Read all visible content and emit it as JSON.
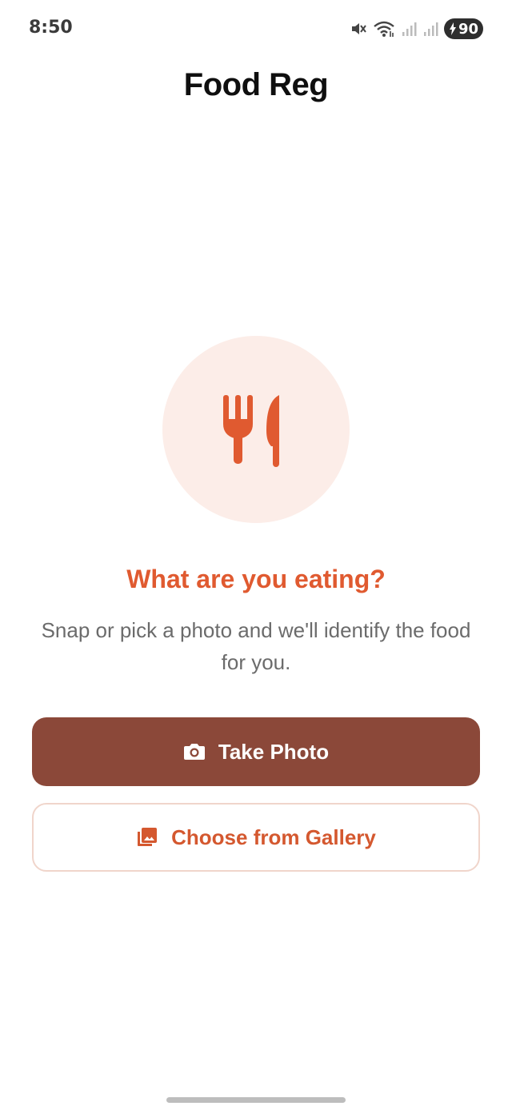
{
  "status_bar": {
    "time": "8:50",
    "battery_level": "90",
    "icons": [
      "mute-icon",
      "wifi-icon",
      "signal-icon",
      "signal-icon",
      "battery-charging-icon"
    ]
  },
  "header": {
    "title": "Food Reg"
  },
  "hero": {
    "icon": "fork-knife-icon",
    "headline": "What are you eating?",
    "subtitle": "Snap or pick a photo and we'll identify the food for you."
  },
  "actions": {
    "take_photo_label": "Take Photo",
    "take_photo_icon": "camera-icon",
    "gallery_label": "Choose from Gallery",
    "gallery_icon": "photo-library-icon"
  },
  "colors": {
    "accent": "#e05a30",
    "primary_button": "#8b4839",
    "hero_circle": "#fcede8",
    "secondary_border": "#f0d5cb"
  }
}
